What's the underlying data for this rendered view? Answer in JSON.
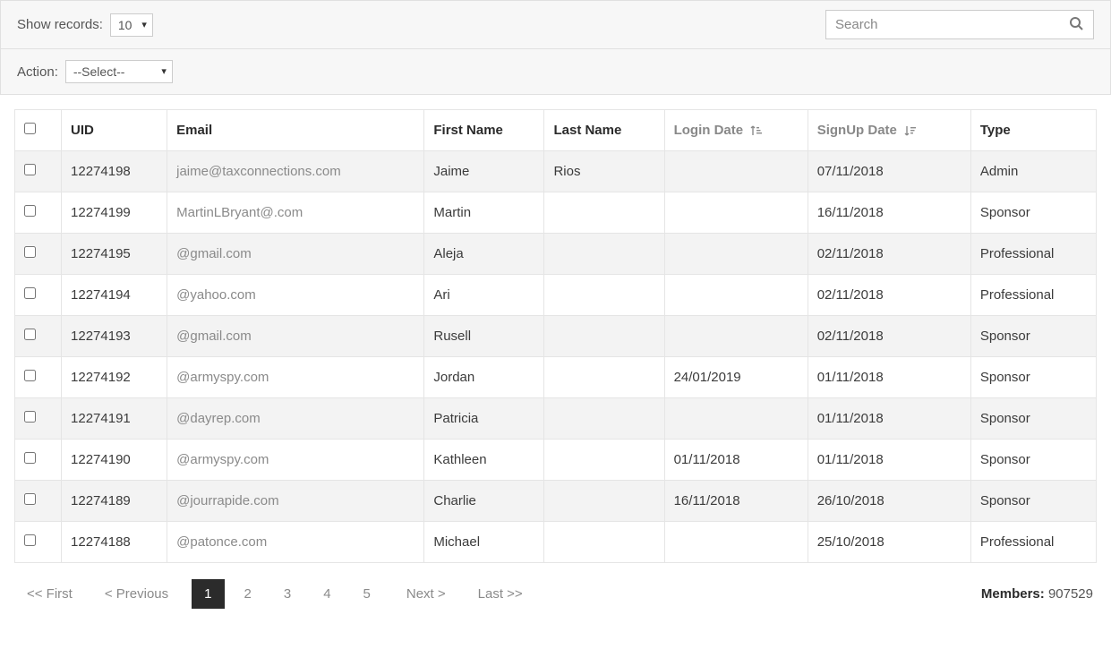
{
  "toolbar": {
    "show_records_label": "Show records:",
    "show_records_value": "10",
    "search_placeholder": "Search",
    "action_label": "Action:",
    "action_value": "--Select--"
  },
  "columns": {
    "uid": "UID",
    "email": "Email",
    "first_name": "First Name",
    "last_name": "Last Name",
    "login_date": "Login Date",
    "signup_date": "SignUp Date",
    "type": "Type"
  },
  "rows": [
    {
      "uid": "12274198",
      "email": "jaime@taxconnections.com",
      "first_name": "Jaime",
      "last_name": "Rios",
      "login_date": "",
      "signup_date": "07/11/2018",
      "type": "Admin"
    },
    {
      "uid": "12274199",
      "email": "MartinLBryant@.com",
      "first_name": "Martin",
      "last_name": "",
      "login_date": "",
      "signup_date": "16/11/2018",
      "type": "Sponsor"
    },
    {
      "uid": "12274195",
      "email": "@gmail.com",
      "first_name": "Aleja",
      "last_name": "",
      "login_date": "",
      "signup_date": "02/11/2018",
      "type": "Professional"
    },
    {
      "uid": "12274194",
      "email": "@yahoo.com",
      "first_name": "Ari",
      "last_name": "",
      "login_date": "",
      "signup_date": "02/11/2018",
      "type": "Professional"
    },
    {
      "uid": "12274193",
      "email": "@gmail.com",
      "first_name": "Rusell",
      "last_name": "",
      "login_date": "",
      "signup_date": "02/11/2018",
      "type": "Sponsor"
    },
    {
      "uid": "12274192",
      "email": "@armyspy.com",
      "first_name": "Jordan",
      "last_name": "",
      "login_date": "24/01/2019",
      "signup_date": "01/11/2018",
      "type": "Sponsor"
    },
    {
      "uid": "12274191",
      "email": "@dayrep.com",
      "first_name": "Patricia",
      "last_name": "",
      "login_date": "",
      "signup_date": "01/11/2018",
      "type": "Sponsor"
    },
    {
      "uid": "12274190",
      "email": "@armyspy.com",
      "first_name": "Kathleen",
      "last_name": "",
      "login_date": "01/11/2018",
      "signup_date": "01/11/2018",
      "type": "Sponsor"
    },
    {
      "uid": "12274189",
      "email": "@jourrapide.com",
      "first_name": "Charlie",
      "last_name": "",
      "login_date": "16/11/2018",
      "signup_date": "26/10/2018",
      "type": "Sponsor"
    },
    {
      "uid": "12274188",
      "email": "@patonce.com",
      "first_name": "Michael",
      "last_name": "",
      "login_date": "",
      "signup_date": "25/10/2018",
      "type": "Professional"
    }
  ],
  "pagination": {
    "first": "<<  First",
    "previous": "<  Previous",
    "next": "Next  >",
    "last": "Last  >>",
    "pages": [
      "1",
      "2",
      "3",
      "4",
      "5"
    ],
    "active_index": 0
  },
  "footer": {
    "members_label": "Members:",
    "members_count": "907529"
  }
}
